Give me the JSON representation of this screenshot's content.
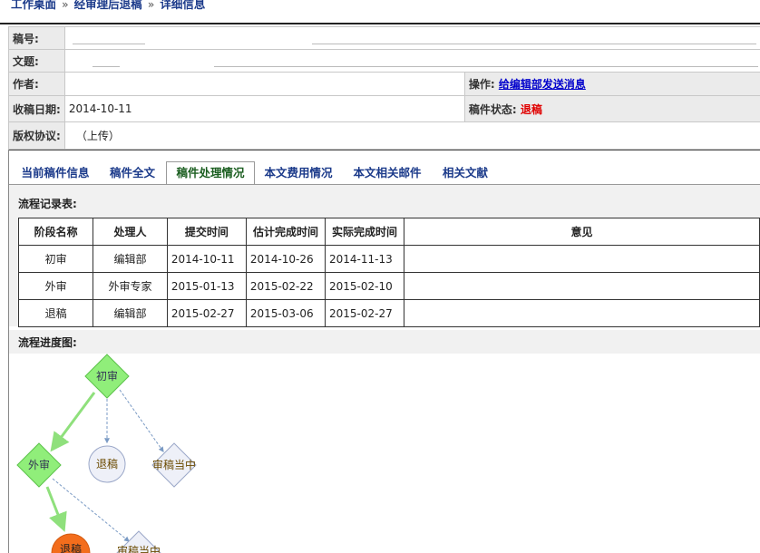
{
  "breadcrumb": {
    "items": [
      "工作桌面",
      "经审理后退稿",
      "详细信息"
    ],
    "separator": "»"
  },
  "info": {
    "manuscript_no_label": "稿号:",
    "title_label": "文题:",
    "author_label": "作者:",
    "received_date_label": "收稿日期:",
    "received_date": "2014-10-11",
    "copyright_label": "版权协议:",
    "copyright_value": "（上传）",
    "operation_label": "操作:",
    "operation_link": "给编辑部发送消息",
    "status_label": "稿件状态:",
    "status_value": "退稿"
  },
  "tabs": [
    {
      "label": "当前稿件信息",
      "active": false
    },
    {
      "label": "稿件全文",
      "active": false
    },
    {
      "label": "稿件处理情况",
      "active": true
    },
    {
      "label": "本文费用情况",
      "active": false
    },
    {
      "label": "本文相关邮件",
      "active": false
    },
    {
      "label": "相关文献",
      "active": false
    }
  ],
  "flow_record": {
    "title": "流程记录表:",
    "headers": [
      "阶段名称",
      "处理人",
      "提交时间",
      "估计完成时间",
      "实际完成时间",
      "意见"
    ],
    "rows": [
      [
        "初审",
        "编辑部",
        "2014-10-11",
        "2014-10-26",
        "2014-11-13",
        ""
      ],
      [
        "外审",
        "外审专家",
        "2015-01-13",
        "2015-02-22",
        "2015-02-10",
        ""
      ],
      [
        "退稿",
        "编辑部",
        "2015-02-27",
        "2015-03-06",
        "2015-02-27",
        ""
      ]
    ]
  },
  "flow_diagram": {
    "title": "流程进度图:",
    "nodes": {
      "first_review": "初审",
      "external_review": "外审",
      "reject_1": "退稿",
      "in_review_1": "审稿当中",
      "reject_2": "退稿",
      "in_review_2": "审稿当中"
    },
    "colors": {
      "active": "#90ee7a",
      "done": "#f36d1c",
      "pending": "#eef0f8",
      "active_edge": "#8fe07c",
      "pending_edge": "#7a9ac4"
    }
  }
}
